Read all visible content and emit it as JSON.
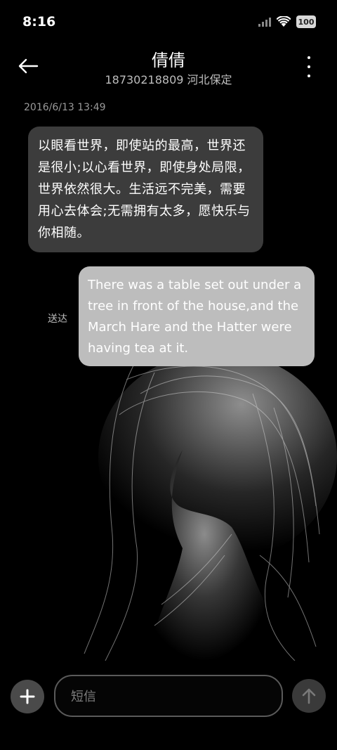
{
  "status_bar": {
    "time": "8:16",
    "battery": "100",
    "icons": [
      "signal-icon",
      "wifi-icon",
      "battery-icon"
    ]
  },
  "header": {
    "contact_name": "倩倩",
    "contact_sub": "18730218809 河北保定",
    "icons": [
      "back-arrow-icon",
      "more-vertical-icon"
    ]
  },
  "conversation": {
    "timestamp": "2016/6/13 13:49",
    "incoming_message": "以眼看世界，即使站的最高，世界还是很小;以心看世界，即使身处局限，世界依然很大。生活远不完美，需要用心去体会;无需拥有太多，愿快乐与你相随。",
    "outgoing_message": "There was a table set out under a tree in front of the house,and the March Hare and the Hatter were having tea at it.",
    "delivered_label": "送达"
  },
  "composer": {
    "placeholder": "短信",
    "icons": [
      "plus-icon",
      "send-arrow-icon"
    ]
  },
  "colors": {
    "background": "#000000",
    "incoming_bubble": "#3c3c3c",
    "outgoing_bubble": "#bdbdbd",
    "muted_text": "#9a9a9a"
  }
}
